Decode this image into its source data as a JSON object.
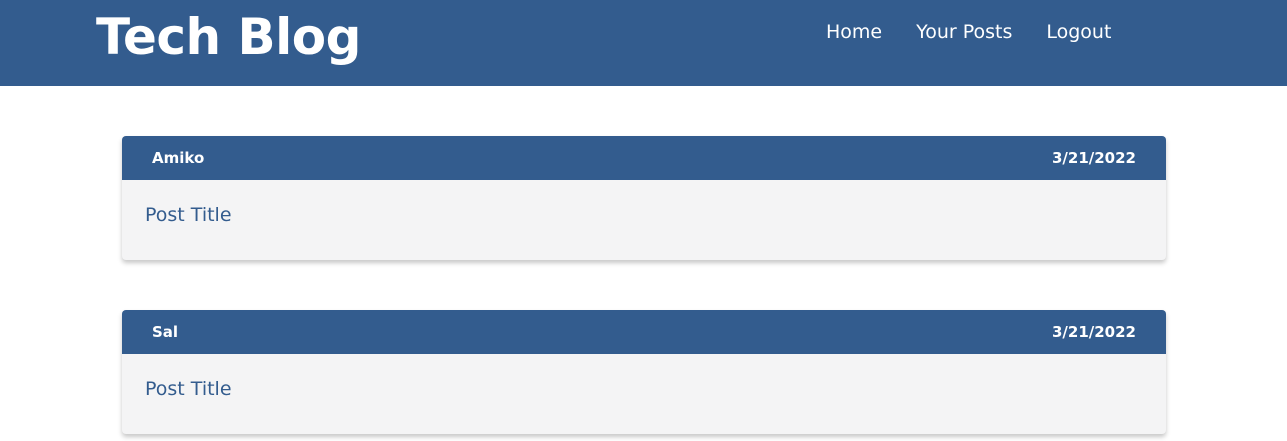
{
  "header": {
    "brand": "Tech Blog",
    "nav": {
      "home": "Home",
      "your_posts": "Your Posts",
      "logout": "Logout"
    }
  },
  "posts": [
    {
      "author": "Amiko",
      "date": "3/21/2022",
      "title": "Post Title"
    },
    {
      "author": "Sal",
      "date": "3/21/2022",
      "title": "Post Title"
    }
  ],
  "colors": {
    "primary": "#335c8e",
    "card_background": "#f4f4f5",
    "text_light": "#ffffff"
  }
}
